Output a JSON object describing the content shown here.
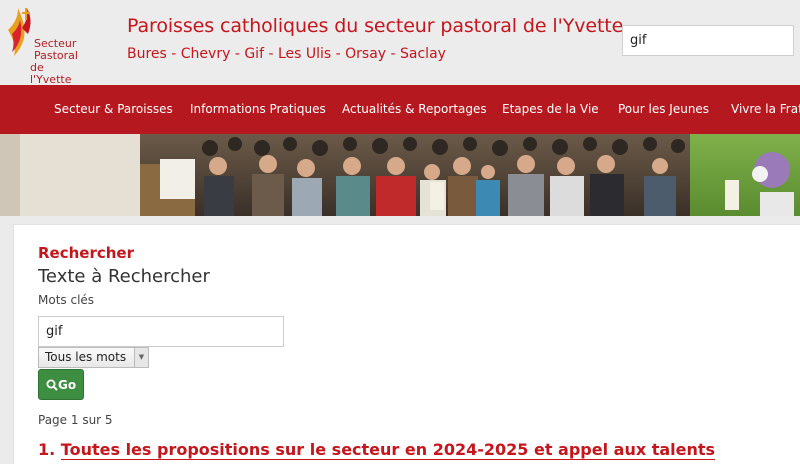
{
  "header": {
    "logo_text": [
      "Secteur",
      "Pastoral",
      "de l'Yvette"
    ],
    "title": "Paroisses catholiques du secteur pastoral de l'Yvette",
    "subtitle": "Bures - Chevry - Gif - Les Ulis - Orsay - Saclay",
    "search_value": "gif"
  },
  "nav": {
    "items": [
      "Secteur & Paroisses",
      "Informations Pratiques",
      "Actualités & Reportages",
      "Etapes de la Vie",
      "Pour les Jeunes",
      "Vivre la Frate"
    ]
  },
  "search": {
    "title": "Rechercher",
    "heading": "Texte à Rechercher",
    "keywords_label": "Mots clés",
    "keywords_value": "gif",
    "mode_selected": "Tous les mots",
    "go_label": "Go"
  },
  "results": {
    "pager": "Page 1 sur 5",
    "items": [
      {
        "number": "1.",
        "title": "Toutes les propositions sur le secteur en 2024-2025 et appel aux talents"
      }
    ]
  },
  "colors": {
    "brand_red": "#c4161c",
    "nav_red": "#b5191f",
    "go_green": "#3e8e41"
  }
}
